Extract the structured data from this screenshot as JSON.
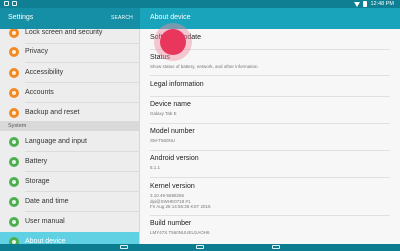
{
  "status_bar": {
    "time": "12:48 PM"
  },
  "left_header": {
    "title": "Settings",
    "search": "SEARCH"
  },
  "right_header": {
    "title": "About device"
  },
  "sidebar": {
    "items": [
      {
        "label": "Lock screen and security",
        "icon": "lock-icon",
        "color": "#f28a24"
      },
      {
        "label": "Privacy",
        "icon": "privacy-icon",
        "color": "#f28a24"
      },
      {
        "label": "Accessibility",
        "icon": "accessibility-icon",
        "color": "#f28a24"
      },
      {
        "label": "Accounts",
        "icon": "key-icon",
        "color": "#f28a24"
      },
      {
        "label": "Backup and reset",
        "icon": "backup-icon",
        "color": "#f28a24"
      }
    ],
    "section_label": "System",
    "system_items": [
      {
        "label": "Language and input",
        "icon": "language-icon",
        "color": "#4caf50"
      },
      {
        "label": "Battery",
        "icon": "battery-icon",
        "color": "#4caf50"
      },
      {
        "label": "Storage",
        "icon": "storage-icon",
        "color": "#4caf50"
      },
      {
        "label": "Date and time",
        "icon": "clock-icon",
        "color": "#4caf50"
      },
      {
        "label": "User manual",
        "icon": "manual-icon",
        "color": "#4caf50"
      },
      {
        "label": "About device",
        "icon": "info-icon",
        "color": "#4caf50"
      }
    ]
  },
  "detail": {
    "software_update": "Software update",
    "status": {
      "title": "Status",
      "sub": "Show status of battery, network, and other information."
    },
    "legal": "Legal information",
    "device_name": {
      "title": "Device name",
      "value": "Galaxy Tab E"
    },
    "model_number": {
      "title": "Model number",
      "value": "SM-T560NU"
    },
    "android_version": {
      "title": "Android version",
      "value": "5.1.1"
    },
    "kernel_version": {
      "title": "Kernel version",
      "lines": [
        "3.10.49-5698265",
        "dpi@SWHE0718 #1",
        "Fri Aug 28 14:56:36 KST 2015"
      ]
    },
    "build_number": {
      "title": "Build number",
      "value": "LMY47X.T560NUUEU1AOH6"
    }
  }
}
